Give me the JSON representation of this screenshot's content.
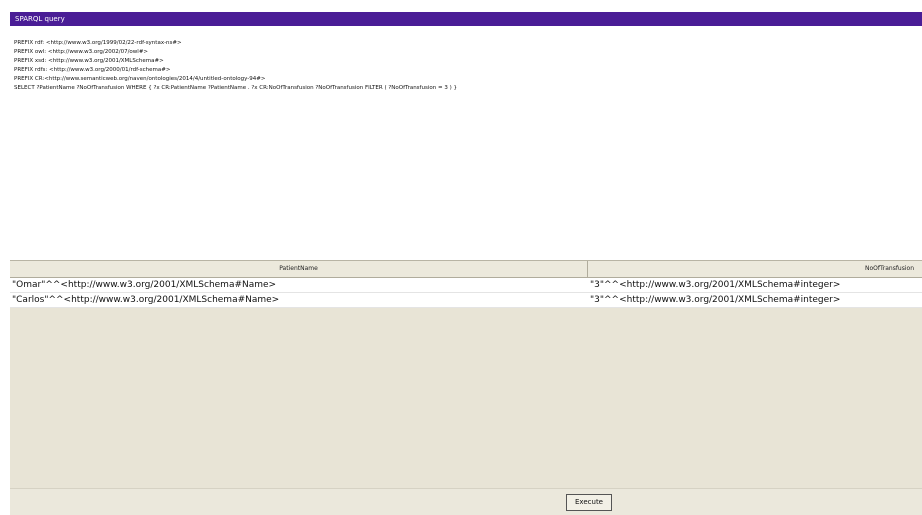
{
  "window": {
    "title": "SPARQL query"
  },
  "query": {
    "lines": [
      "PREFIX rdf: <http://www.w3.org/1999/02/22-rdf-syntax-ns#>",
      "PREFIX owl: <http://www.w3.org/2002/07/owl#>",
      "PREFIX xsd: <http://www.w3.org/2001/XMLSchema#>",
      "PREFIX rdfs: <http://www.w3.org/2000/01/rdf-schema#>",
      "PREFIX CR:<http://www.semanticweb.org/naven/ontologies/2014/4/untitled-ontology-94#>",
      "SELECT ?PatientName ?NoOfTransfusion WHERE { ?x CR:PatientName ?PatientName . ?x CR:NoOfTransfusion ?NoOfTransfusion FILTER ( ?NoOfTransfusion = 3 ) }"
    ]
  },
  "results": {
    "columns": [
      "PatientName",
      "NoOfTransfusion"
    ],
    "rows": [
      [
        "\"Omar\"^^<http://www.w3.org/2001/XMLSchema#Name>",
        "\"3\"^^<http://www.w3.org/2001/XMLSchema#integer>"
      ],
      [
        "\"Carlos\"^^<http://www.w3.org/2001/XMLSchema#Name>",
        "\"3\"^^<http://www.w3.org/2001/XMLSchema#integer>"
      ]
    ]
  },
  "footer": {
    "execute_label": "Execute"
  }
}
